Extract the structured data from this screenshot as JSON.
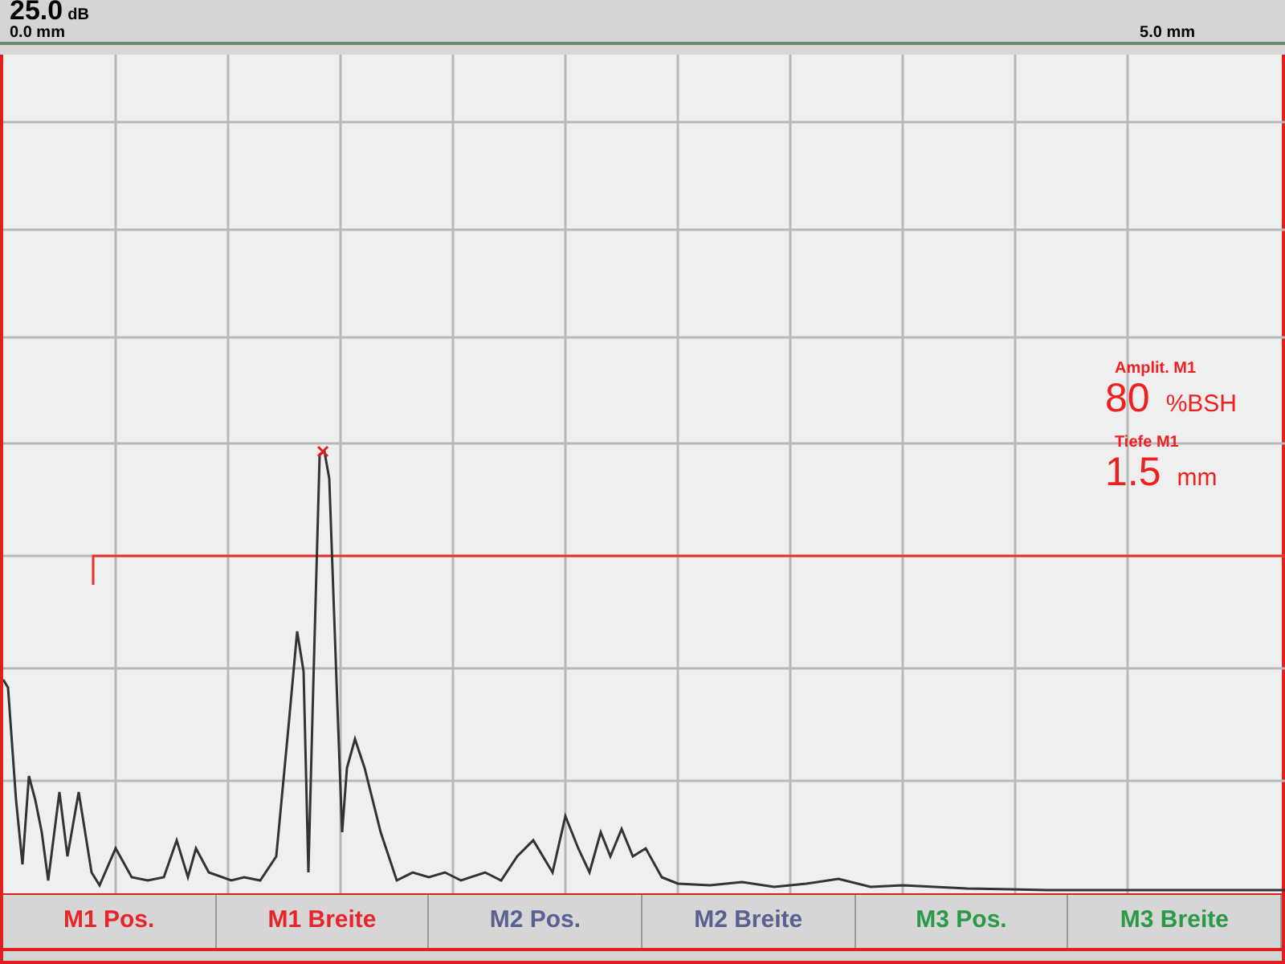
{
  "header": {
    "gain": "25.0",
    "gain_unit": "dB",
    "range_start": "0.0 mm",
    "range_end": "5.0 mm"
  },
  "readings": [
    {
      "label": "Amplit. M1",
      "value": "80",
      "unit": "%BSH"
    },
    {
      "label": "Tiefe M1",
      "value": "1.5",
      "unit": "mm"
    }
  ],
  "buttons": [
    {
      "label": "M1 Pos.",
      "color": "#e8262a"
    },
    {
      "label": "M1 Breite",
      "color": "#e8262a"
    },
    {
      "label": "M2 Pos.",
      "color": "#5a6090"
    },
    {
      "label": "M2 Breite",
      "color": "#5a6090"
    },
    {
      "label": "M3 Pos.",
      "color": "#2a9a48"
    },
    {
      "label": "M3 Breite",
      "color": "#2a9a48"
    }
  ]
}
